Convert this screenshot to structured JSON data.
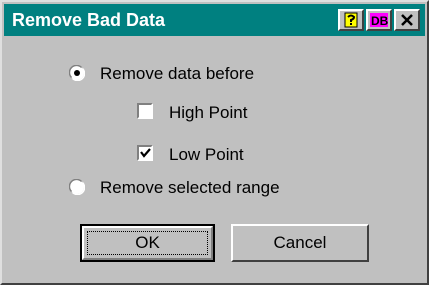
{
  "window": {
    "title": "Remove Bad Data"
  },
  "title_buttons": [
    {
      "name": "help-icon"
    },
    {
      "name": "db-icon",
      "text": "DB"
    },
    {
      "name": "close-icon"
    }
  ],
  "options": {
    "remove_before": {
      "label": "Remove data before",
      "selected": true
    },
    "high_point": {
      "label": "High Point",
      "checked": false
    },
    "low_point": {
      "label": "Low Point",
      "checked": true
    },
    "remove_range": {
      "label": "Remove selected range",
      "selected": false
    }
  },
  "buttons": {
    "ok": "OK",
    "cancel": "Cancel"
  }
}
